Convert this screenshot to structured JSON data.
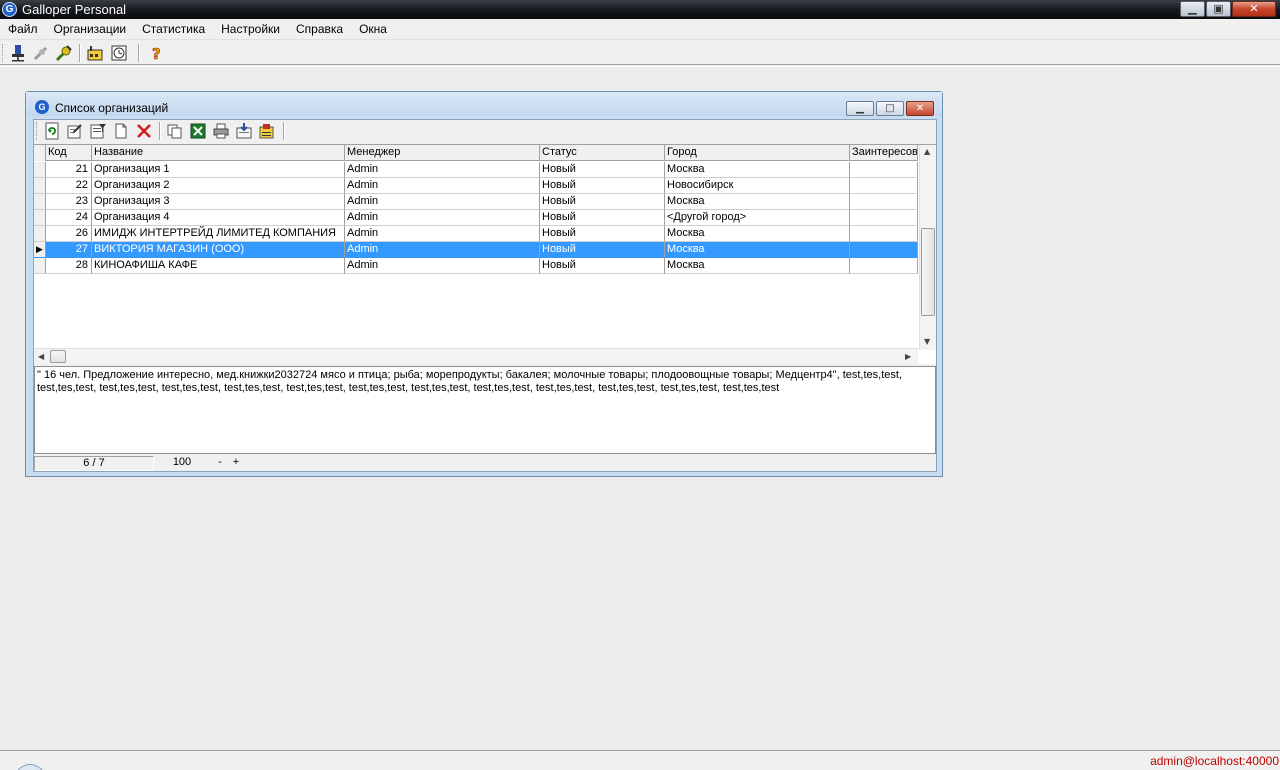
{
  "app": {
    "logo": "G",
    "title": "Galloper Personal"
  },
  "menu": [
    "Файл",
    "Организации",
    "Статистика",
    "Настройки",
    "Справка",
    "Окна"
  ],
  "window": {
    "logo": "G",
    "title": "Список организаций",
    "min_glyph": "▁",
    "max_glyph": "□",
    "close_glyph": "✕"
  },
  "app_controls": {
    "min_glyph": "▁",
    "max_glyph": "▣",
    "close_glyph": "✕"
  },
  "grid": {
    "columns": [
      "",
      "Код",
      "Название",
      "Менеджер",
      "Статус",
      "Город",
      "Заинтересов"
    ],
    "rows": [
      {
        "code": "21",
        "name": "Организация 1",
        "manager": "Admin",
        "status": "Новый",
        "city": "Москва",
        "interest": ""
      },
      {
        "code": "22",
        "name": "Организация 2",
        "manager": "Admin",
        "status": "Новый",
        "city": "Новосибирск",
        "interest": ""
      },
      {
        "code": "23",
        "name": "Организация 3",
        "manager": "Admin",
        "status": "Новый",
        "city": "Москва",
        "interest": ""
      },
      {
        "code": "24",
        "name": "Организация 4",
        "manager": "Admin",
        "status": "Новый",
        "city": "<Другой город>",
        "interest": ""
      },
      {
        "code": "26",
        "name": "ИМИДЖ ИНТЕРТРЕЙД ЛИМИТЕД КОМПАНИЯ",
        "manager": "Admin",
        "status": "Новый",
        "city": "Москва",
        "interest": ""
      },
      {
        "code": "27",
        "name": "ВИКТОРИЯ МАГАЗИН (ООО)",
        "manager": "Admin",
        "status": "Новый",
        "city": "Москва",
        "interest": ""
      },
      {
        "code": "28",
        "name": "КИНОАФИША КАФЕ",
        "manager": "Admin",
        "status": "Новый",
        "city": "Москва",
        "interest": ""
      }
    ],
    "selected_row": 5,
    "row_indicator": "▶"
  },
  "memo": {
    "line1": "\" 16 чел. Предложение интересно, мед.книжки2032724 мясо и птица; рыба; морепродукты; бакалея; молочные товары; плодоовощные товары; Медцентр4\", test,tes,test,",
    "line2": "test,tes,test, test,tes,test, test,tes,test, test,tes,test, test,tes,test, test,tes,test, test,tes,test, test,tes,test, test,tes,test, test,tes,test, test,tes,test, test,tes,test"
  },
  "child_status": {
    "position": "6 / 7",
    "zoom": "100",
    "minus": "-",
    "plus": "+"
  },
  "app_status": {
    "connection": "admin@localhost:40000"
  },
  "icons": {
    "main_toolbar": [
      "connect-icon",
      "disconnect-icon",
      "plugin-icon",
      "factory-icon",
      "clock-icon",
      "help-icon"
    ],
    "child_toolbar": [
      "refresh-icon",
      "edit-icon",
      "filter-icon",
      "new-document-icon",
      "delete-icon",
      "copy-icon",
      "excel-icon",
      "print-icon",
      "export-icon",
      "report-icon"
    ]
  }
}
